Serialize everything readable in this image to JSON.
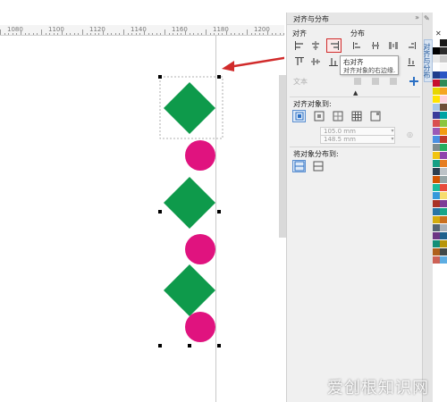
{
  "ruler": {
    "labels": [
      "1080",
      "1100",
      "1120",
      "1140",
      "1160",
      "1180",
      "1200"
    ]
  },
  "panel": {
    "title": "对齐与分布",
    "align_label": "对齐",
    "distribute_label": "分布",
    "text_label": "文本",
    "align_to_label": "对齐对象到:",
    "x_field": "105.0 mm",
    "y_field": "148.5 mm",
    "distribute_to_label": "将对象分布到:"
  },
  "tooltip": {
    "title": "右对齐",
    "desc": "对齐对象的右边缘."
  },
  "side_tab": {
    "label": "对齐与分布"
  },
  "watermark": {
    "text": "爱创根知识网"
  },
  "colors": {
    "diamond": "#0e9a4b",
    "circle": "#e0137f",
    "highlight": "#d12b2b",
    "arrow": "#d12b2b"
  },
  "palette": [
    "#ffffff",
    "#1a1a1a",
    "#000000",
    "#2b2b2b",
    "#e8e8e8",
    "#cccccc",
    "#ffffff",
    "#f6f6f6",
    "#1e3c8c",
    "#2a56c4",
    "#c8102e",
    "#2e8b57",
    "#e6d600",
    "#f5a623",
    "#ffe400",
    "#ffd1dc",
    "#a7c7e7",
    "#6f4e37",
    "#3b3b9a",
    "#00a3a3",
    "#d94f4f",
    "#8cc63f",
    "#9b59b6",
    "#f39c12",
    "#4a90e2",
    "#c0392b",
    "#7f8c8d",
    "#27ae60",
    "#f1c40f",
    "#8e44ad",
    "#16a085",
    "#e67e22",
    "#2c3e50",
    "#bdc3c7",
    "#d35400",
    "#95a5a6",
    "#1abc9c",
    "#e74c3c",
    "#3498db",
    "#f7dc6f",
    "#a93226",
    "#7d3c98",
    "#2874a6",
    "#17a589",
    "#d4ac0d",
    "#ca6f1e",
    "#566573",
    "#abb2b9",
    "#6c3483",
    "#1f618d",
    "#148f77",
    "#b7950b",
    "#af601a",
    "#424949",
    "#cd6155",
    "#5dade2"
  ]
}
